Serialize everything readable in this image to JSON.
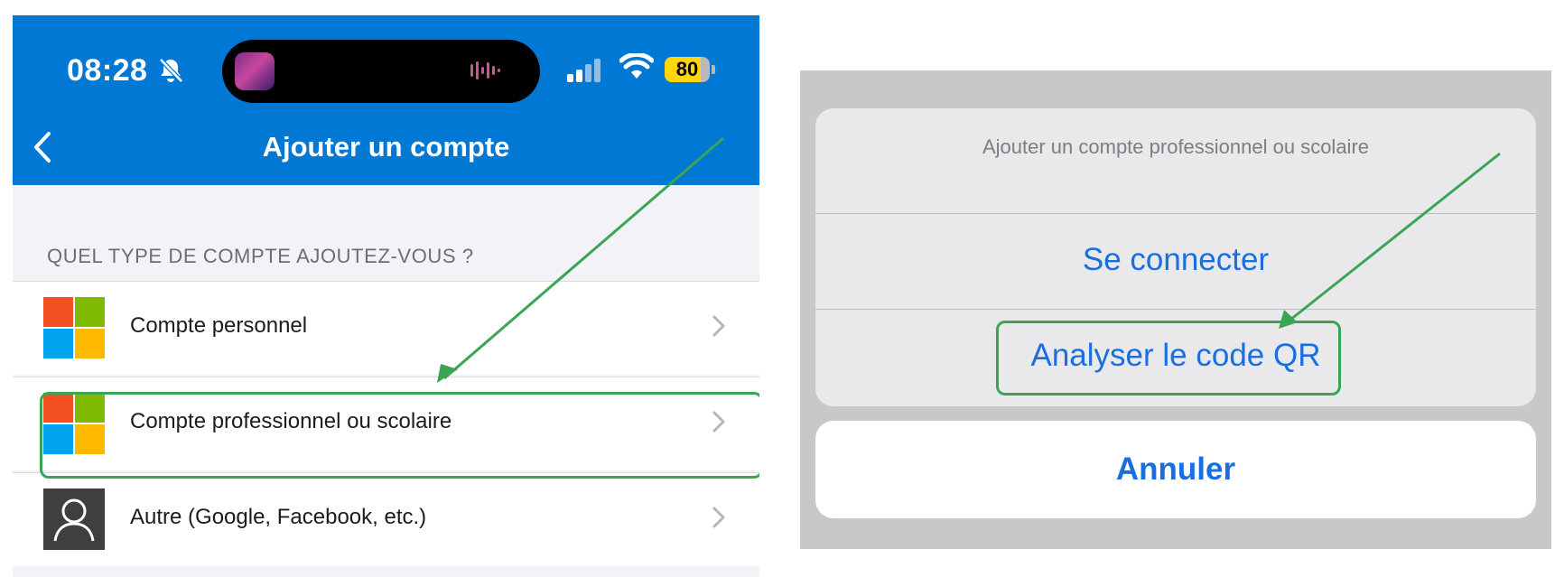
{
  "status_bar": {
    "time": "08:28",
    "battery": "80",
    "battery_level": 0.8,
    "icons": [
      "silent-bell-icon",
      "audio-wave-icon",
      "signal-bars-icon",
      "wifi-icon",
      "battery-icon"
    ]
  },
  "nav": {
    "title": "Ajouter un compte",
    "back_icon": "chevron-left-icon"
  },
  "section_header": "QUEL TYPE DE COMPTE AJOUTEZ-VOUS ?",
  "accounts": [
    {
      "label": "Compte personnel",
      "icon": "microsoft-logo"
    },
    {
      "label": "Compte professionnel ou scolaire",
      "icon": "microsoft-logo"
    },
    {
      "label": "Autre (Google, Facebook, etc.)",
      "icon": "person-icon"
    }
  ],
  "action_sheet": {
    "title": "Ajouter un compte professionnel ou scolaire",
    "options": [
      "Se connecter",
      "Analyser le code QR"
    ],
    "cancel": "Annuler"
  },
  "colors": {
    "header_blue": "#0078d4",
    "ios_blue": "#1a6fe0",
    "highlight_green": "#3aa655"
  }
}
